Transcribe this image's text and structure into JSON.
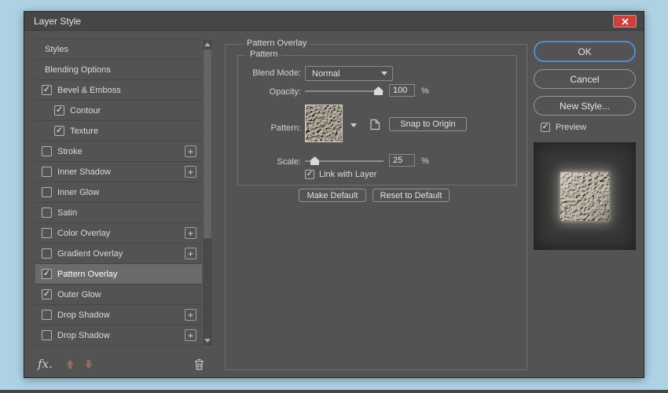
{
  "window": {
    "title": "Layer Style"
  },
  "sidebar": {
    "items": [
      {
        "label": "Styles",
        "checkbox": null,
        "plus": false,
        "indent": 0,
        "selected": false
      },
      {
        "label": "Blending Options",
        "checkbox": null,
        "plus": false,
        "indent": 0,
        "selected": false
      },
      {
        "label": "Bevel & Emboss",
        "checkbox": true,
        "plus": false,
        "indent": 0,
        "selected": false
      },
      {
        "label": "Contour",
        "checkbox": true,
        "plus": false,
        "indent": 1,
        "selected": false
      },
      {
        "label": "Texture",
        "checkbox": true,
        "plus": false,
        "indent": 1,
        "selected": false
      },
      {
        "label": "Stroke",
        "checkbox": false,
        "plus": true,
        "indent": 0,
        "selected": false
      },
      {
        "label": "Inner Shadow",
        "checkbox": false,
        "plus": true,
        "indent": 0,
        "selected": false
      },
      {
        "label": "Inner Glow",
        "checkbox": false,
        "plus": false,
        "indent": 0,
        "selected": false
      },
      {
        "label": "Satin",
        "checkbox": false,
        "plus": false,
        "indent": 0,
        "selected": false
      },
      {
        "label": "Color Overlay",
        "checkbox": false,
        "plus": true,
        "indent": 0,
        "selected": false
      },
      {
        "label": "Gradient Overlay",
        "checkbox": false,
        "plus": true,
        "indent": 0,
        "selected": false
      },
      {
        "label": "Pattern Overlay",
        "checkbox": true,
        "plus": false,
        "indent": 0,
        "selected": true
      },
      {
        "label": "Outer Glow",
        "checkbox": true,
        "plus": false,
        "indent": 0,
        "selected": false
      },
      {
        "label": "Drop Shadow",
        "checkbox": false,
        "plus": true,
        "indent": 0,
        "selected": false
      },
      {
        "label": "Drop Shadow",
        "checkbox": false,
        "plus": true,
        "indent": 0,
        "selected": false
      }
    ],
    "footer": {
      "fx_label": "fx."
    }
  },
  "panel": {
    "group_title": "Pattern Overlay",
    "subgroup_title": "Pattern",
    "blend_mode": {
      "label": "Blend Mode:",
      "value": "Normal"
    },
    "opacity": {
      "label": "Opacity:",
      "value": "100",
      "unit": "%"
    },
    "pattern": {
      "label": "Pattern:",
      "snap_button": "Snap to Origin"
    },
    "scale": {
      "label": "Scale:",
      "value": "25",
      "unit": "%"
    },
    "link_label": "Link with Layer",
    "make_default_button": "Make Default",
    "reset_default_button": "Reset to Default"
  },
  "actions": {
    "ok_button": "OK",
    "cancel_button": "Cancel",
    "new_style_button": "New Style...",
    "preview_label": "Preview"
  }
}
